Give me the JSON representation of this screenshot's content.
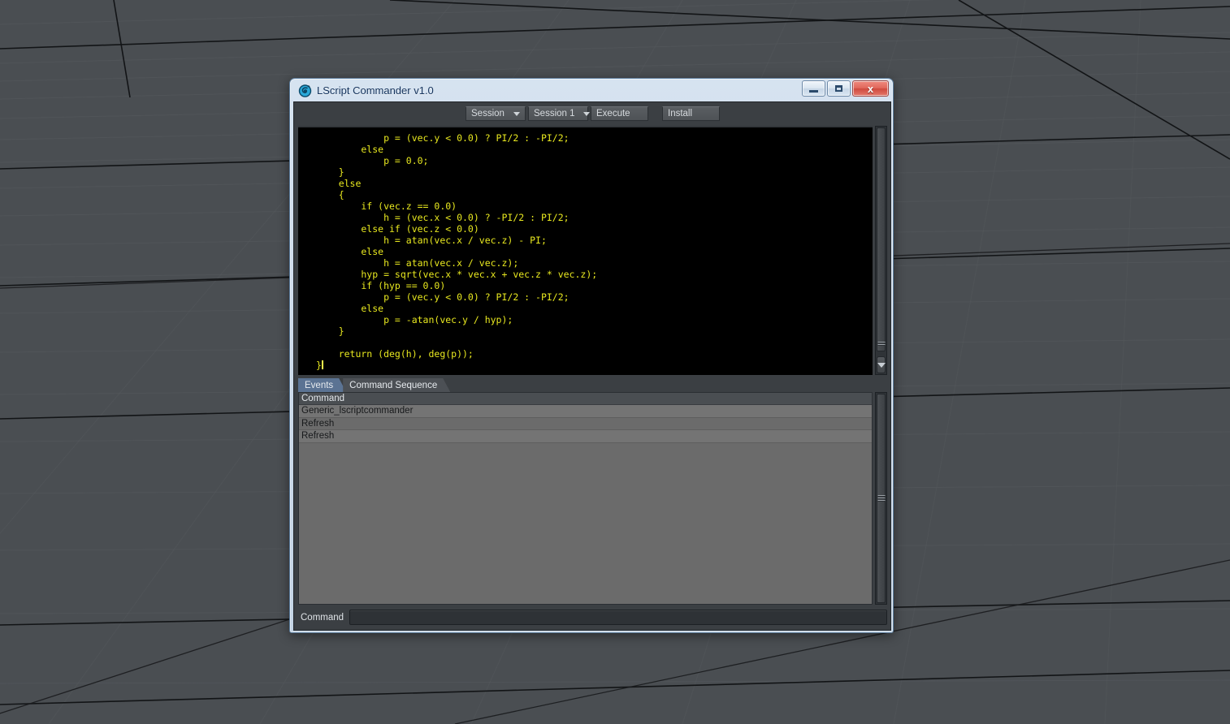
{
  "window": {
    "title": "LScript Commander v1.0",
    "icon": "lscript-commander-icon",
    "buttons": {
      "minimize": "minimize-button",
      "maximize": "maximize-button",
      "close_label": "x"
    }
  },
  "toolbar": {
    "session_mode": "Session",
    "session_number": "Session 1",
    "execute_label": "Execute",
    "install_label": "Install"
  },
  "editor": {
    "language": "LScript",
    "text_color": "#e8e81f",
    "background": "#000000",
    "lines": [
      "            p = (vec.y < 0.0) ? PI/2 : -PI/2;",
      "        else",
      "            p = 0.0;",
      "    }",
      "    else",
      "    {",
      "        if (vec.z == 0.0)",
      "            h = (vec.x < 0.0) ? -PI/2 : PI/2;",
      "        else if (vec.z < 0.0)",
      "            h = atan(vec.x / vec.z) - PI;",
      "        else",
      "            h = atan(vec.x / vec.z);",
      "        hyp = sqrt(vec.x * vec.x + vec.z * vec.z);",
      "        if (hyp == 0.0)",
      "            p = (vec.y < 0.0) ? PI/2 : -PI/2;",
      "        else",
      "            p = -atan(vec.y / hyp);",
      "    }",
      "",
      "    return (deg(h), deg(p));",
      "}"
    ]
  },
  "tabs": [
    {
      "label": "Events",
      "active": true
    },
    {
      "label": "Command Sequence",
      "active": false
    }
  ],
  "events_list": {
    "column_header": "Command",
    "rows": [
      "Generic_lscriptcommander",
      "Refresh",
      "Refresh"
    ]
  },
  "command_bar": {
    "label": "Command",
    "value": "",
    "placeholder": ""
  },
  "colors": {
    "window_chrome": "#cfdceb",
    "client_background": "#3b3f43",
    "active_tab": "#5b7393",
    "inactive_tab": "#4c5055",
    "list_background": "#6b6b6b",
    "viewport_background": "#4a4e52",
    "code_text": "#e8e81f",
    "close_button": "#cf4a3e"
  }
}
